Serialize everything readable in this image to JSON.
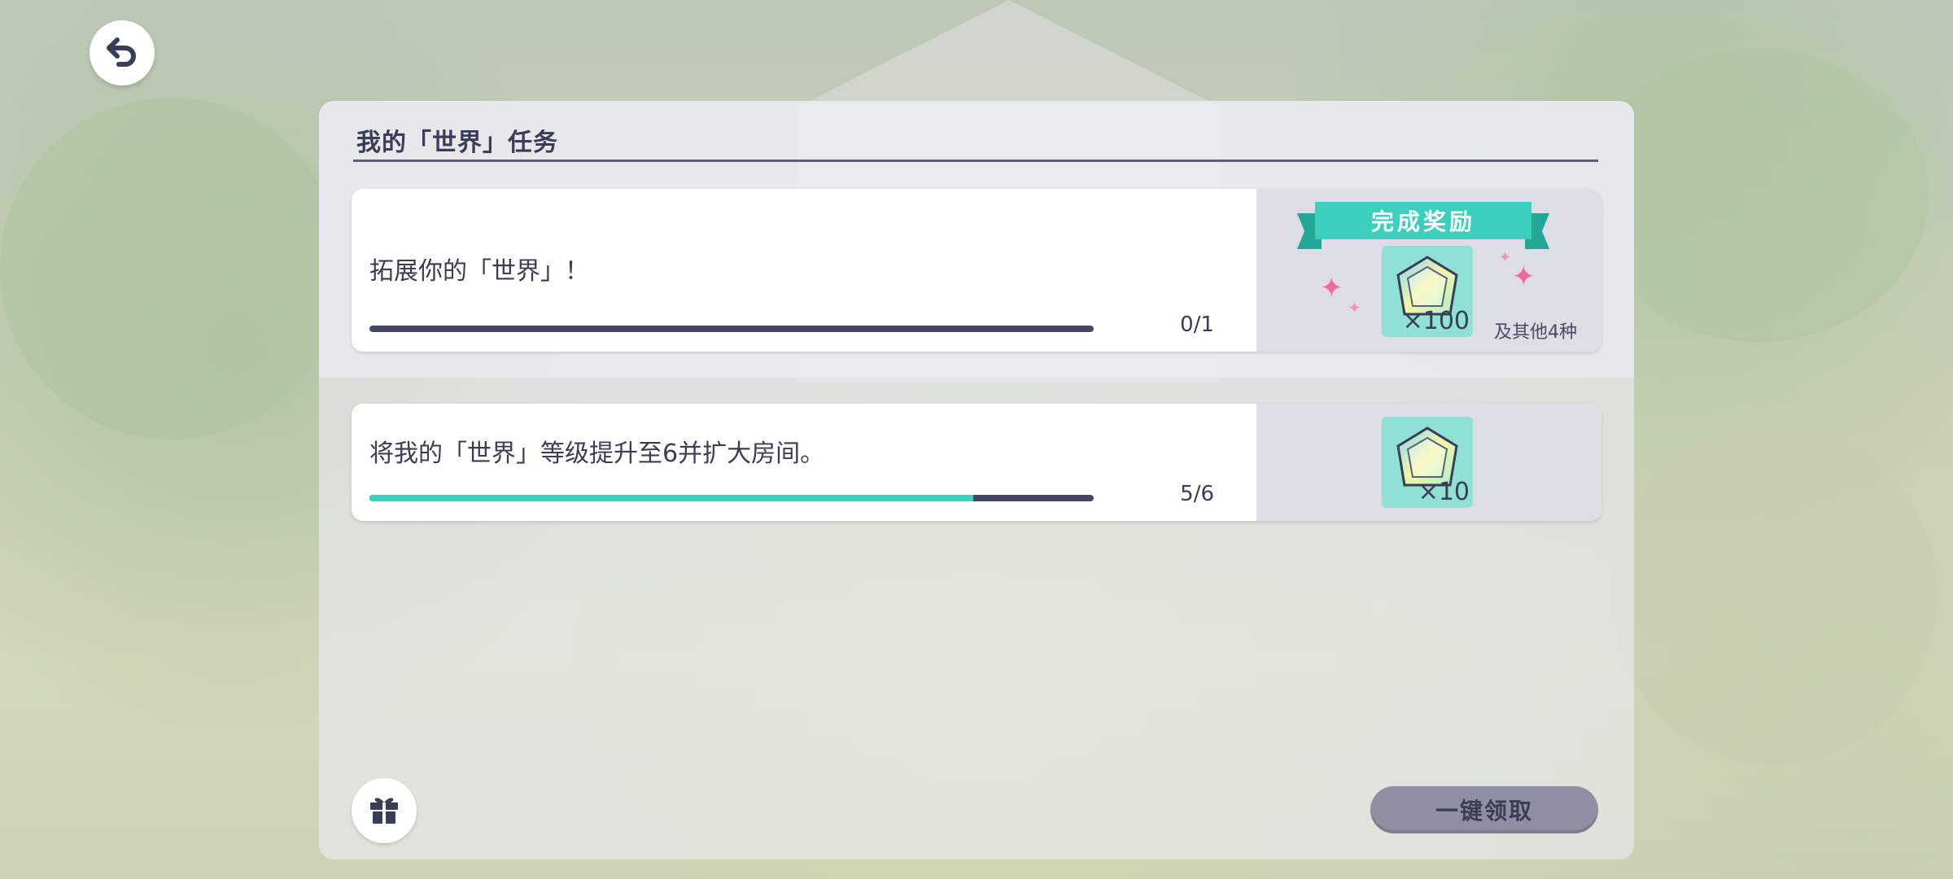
{
  "header": {
    "back_icon": "back-arrow-icon"
  },
  "panel": {
    "title": "我的「世界」任务"
  },
  "tasks": [
    {
      "description": "拓展你的「世界」！",
      "progress_text": "0/1",
      "progress_fraction": 0,
      "reward_banner": "完成奖励",
      "reward_icon": "crystal-gem-icon",
      "reward_quantity": "×100",
      "reward_more": "及其他4种"
    },
    {
      "description": "将我的「世界」等级提升至6并扩大房间。",
      "progress_text": "5/6",
      "progress_fraction": 0.8333,
      "reward_icon": "crystal-gem-icon",
      "reward_quantity": "×10"
    }
  ],
  "footer": {
    "gift_icon": "gift-icon",
    "claim_all_label": "一键领取"
  },
  "colors": {
    "accent_teal": "#3ad0bd",
    "text_dark": "#3b3d55",
    "claim_button": "#8e8fa3",
    "sparkle_pink": "#f06a9a"
  }
}
